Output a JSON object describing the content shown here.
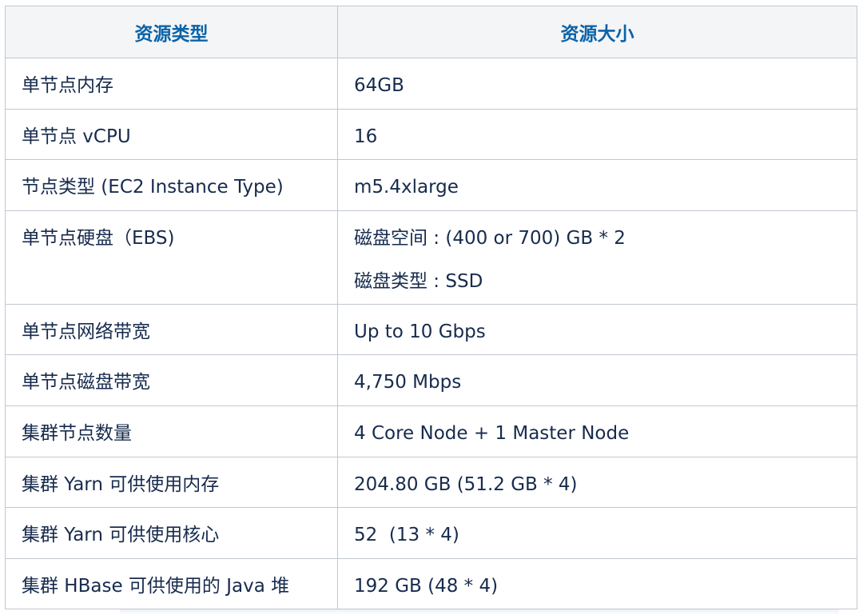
{
  "table": {
    "headers": [
      "资源类型",
      "资源大小"
    ],
    "rows": [
      {
        "type": "单节点内存",
        "size": [
          "64GB"
        ]
      },
      {
        "type": "单节点 vCPU",
        "size": [
          "16"
        ]
      },
      {
        "type": "节点类型 (EC2 Instance Type)",
        "size": [
          "m5.4xlarge"
        ]
      },
      {
        "type": "单节点硬盘（EBS)",
        "size": [
          "磁盘空间 : (400 or 700) GB * 2",
          "磁盘类型 : SSD"
        ]
      },
      {
        "type": "单节点网络带宽",
        "size": [
          "Up to 10 Gbps"
        ]
      },
      {
        "type": "单节点磁盘带宽",
        "size": [
          "4,750 Mbps"
        ]
      },
      {
        "type": "集群节点数量",
        "size": [
          "4 Core Node + 1 Master Node"
        ]
      },
      {
        "type": "集群 Yarn 可供使用内存",
        "size": [
          "204.80 GB (51.2 GB * 4)"
        ]
      },
      {
        "type": "集群 Yarn 可供使用核心",
        "size": [
          "52  (13 * 4)"
        ]
      },
      {
        "type": "集群 HBase 可供使用的 Java 堆",
        "size": [
          "192 GB (48 * 4)"
        ]
      }
    ]
  },
  "colors": {
    "header_text": "#0b63a8",
    "header_bg": "#f4f5f7",
    "border": "#c1c7d0",
    "body_text": "#172b4d"
  }
}
